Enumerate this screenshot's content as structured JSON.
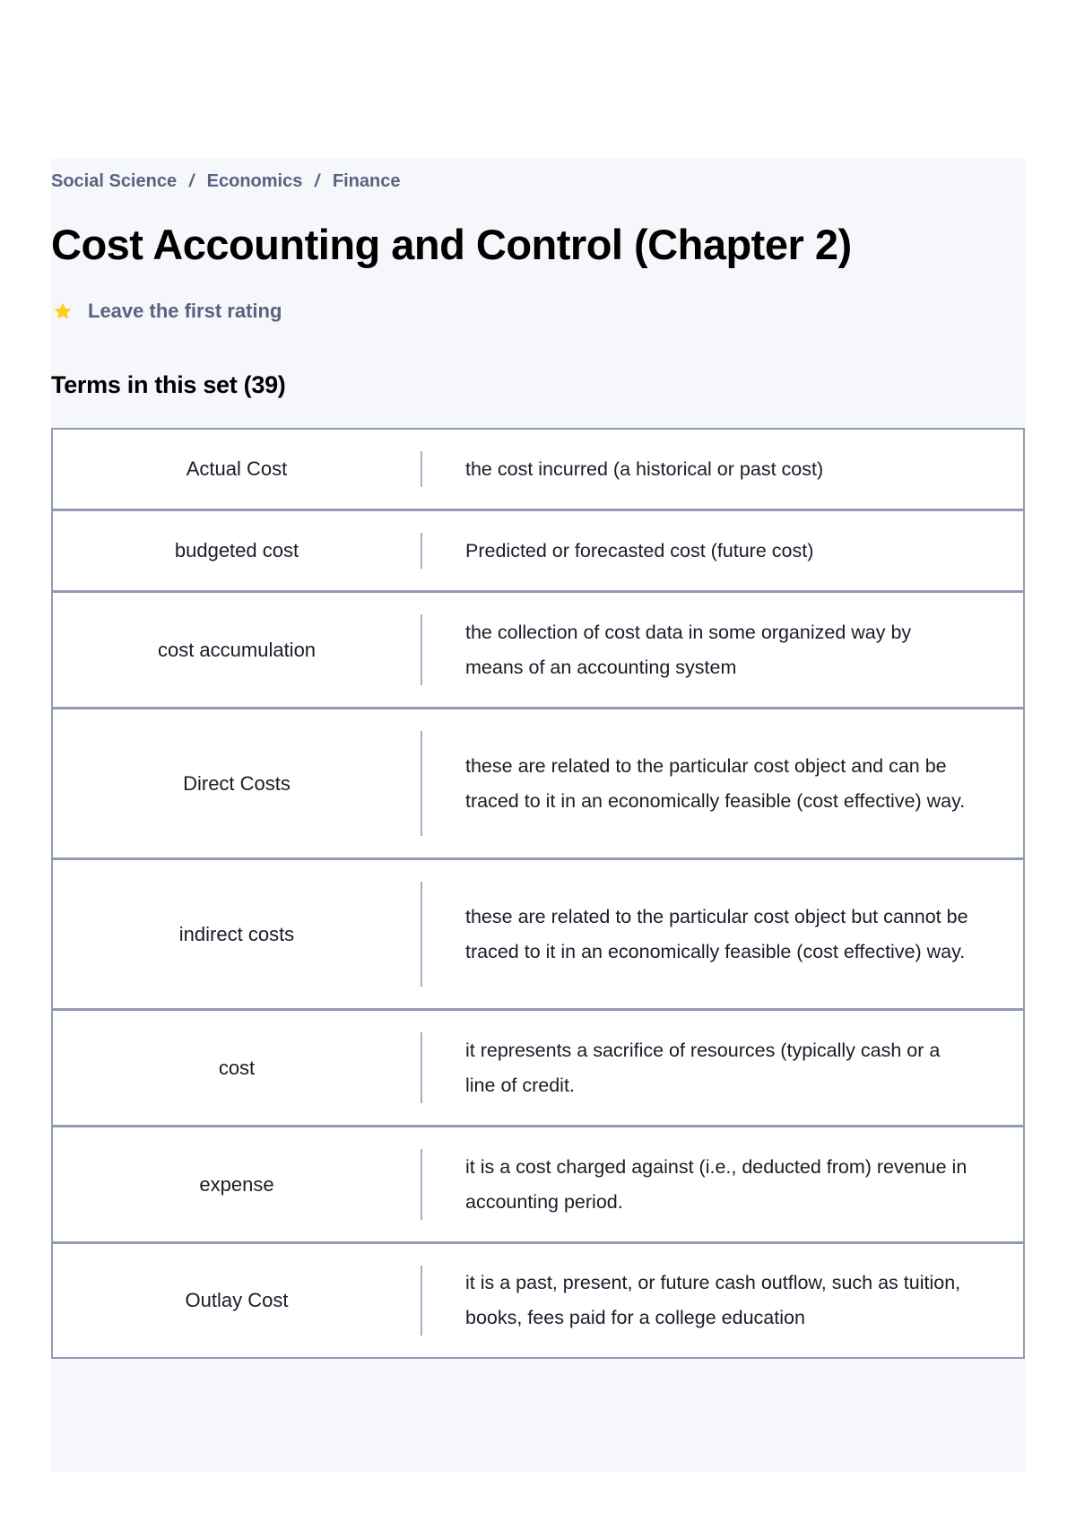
{
  "breadcrumb": [
    {
      "label": "Social Science"
    },
    {
      "label": "Economics"
    },
    {
      "label": "Finance"
    }
  ],
  "breadcrumb_separator": "/",
  "title": "Cost Accounting and Control (Chapter 2)",
  "rating": {
    "icon": "star-icon",
    "star_color": "#ffcd1f",
    "label": "Leave the first rating"
  },
  "terms_heading": "Terms in this set (39)",
  "terms": [
    {
      "term": "Actual Cost",
      "definition": "the cost incurred (a historical or past cost)"
    },
    {
      "term": "budgeted cost",
      "definition": "Predicted or forecasted cost (future cost)"
    },
    {
      "term": "cost accumulation",
      "definition": "the collection of cost data in some organized way by means of an accounting system"
    },
    {
      "term": "Direct Costs",
      "definition": "these are related to the particular cost object and can be traced to it in an economically feasible (cost effective) way."
    },
    {
      "term": "indirect costs",
      "definition": "these are related to the particular cost object but cannot be traced to it in an economically feasible (cost effective) way."
    },
    {
      "term": "cost",
      "definition": "it represents a sacrifice of resources (typically cash or a line of credit."
    },
    {
      "term": "expense",
      "definition": "it is a cost charged against (i.e., deducted from) revenue in accounting period."
    },
    {
      "term": "Outlay Cost",
      "definition": "it is a past, present, or future cash outflow, such as tuition, books, fees paid for a college education"
    }
  ],
  "colors": {
    "panel_background": "#f6f7fb",
    "muted_text": "#586380",
    "border": "#939bb4",
    "star": "#ffcd1f"
  }
}
